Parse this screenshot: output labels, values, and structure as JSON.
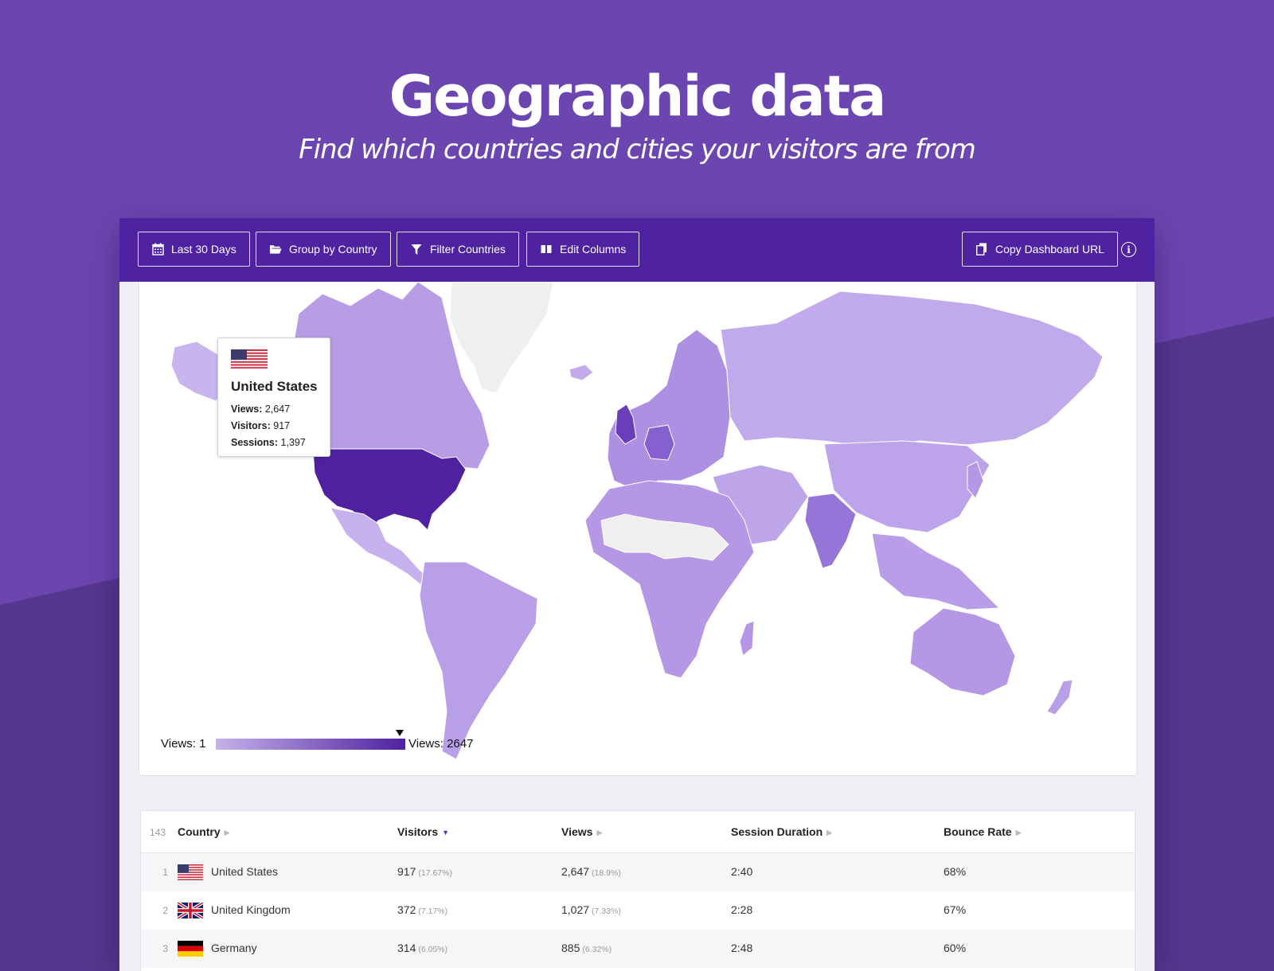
{
  "hero": {
    "title": "Geographic data",
    "subtitle": "Find which countries and cities your visitors are from"
  },
  "toolbar": {
    "date_range": "Last 30 Days",
    "group_by": "Group by Country",
    "filter": "Filter Countries",
    "edit_columns": "Edit Columns",
    "copy_url": "Copy Dashboard URL",
    "info_glyph": "i"
  },
  "map": {
    "tooltip": {
      "country": "United States",
      "views_label": "Views:",
      "views": "2,647",
      "visitors_label": "Visitors:",
      "visitors": "917",
      "sessions_label": "Sessions:",
      "sessions": "1,397"
    },
    "legend": {
      "min_label": "Views: 1",
      "max_label": "Views: 2647",
      "marker_fraction": 0.97
    },
    "colors": {
      "lowest": "#c5b1ea",
      "highest": "#4f21a0",
      "no_data": "#eeeeee"
    }
  },
  "table": {
    "count": "143",
    "columns": {
      "country": "Country",
      "visitors": "Visitors",
      "views": "Views",
      "session_duration": "Session Duration",
      "bounce_rate": "Bounce Rate"
    },
    "rows": [
      {
        "rank": "1",
        "country": "United States",
        "visitors": "917",
        "visitors_pct": "(17.67%)",
        "views": "2,647",
        "views_pct": "(18.9%)",
        "duration": "2:40",
        "bounce": "68%"
      },
      {
        "rank": "2",
        "country": "United Kingdom",
        "visitors": "372",
        "visitors_pct": "(7.17%)",
        "views": "1,027",
        "views_pct": "(7.33%)",
        "duration": "2:28",
        "bounce": "67%"
      },
      {
        "rank": "3",
        "country": "Germany",
        "visitors": "314",
        "visitors_pct": "(6.05%)",
        "views": "885",
        "views_pct": "(6.32%)",
        "duration": "2:48",
        "bounce": "60%"
      }
    ]
  }
}
